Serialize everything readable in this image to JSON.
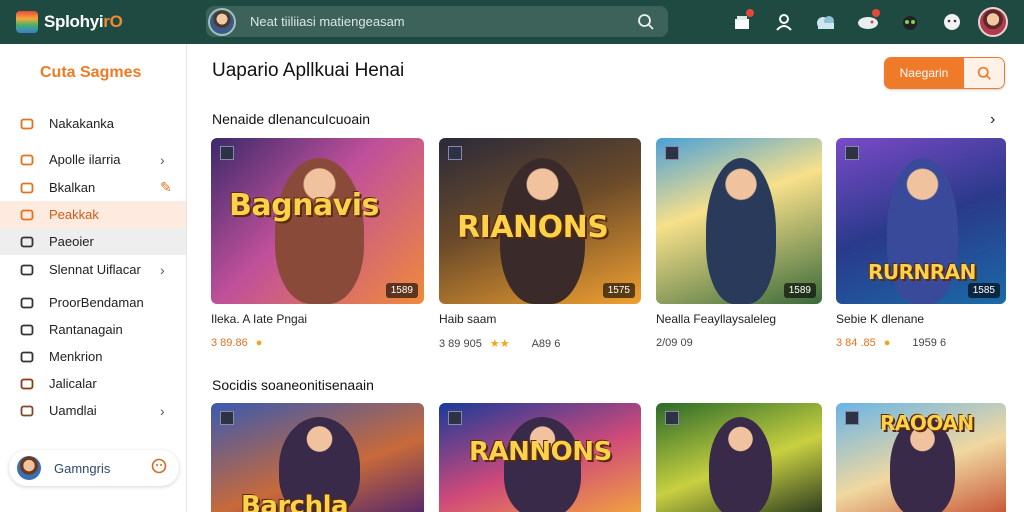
{
  "app": {
    "logo_text": "Splohyi",
    "logo_accent": "rO",
    "search_placeholder": "Neat tiiliiasi matiengeasam",
    "colors": {
      "topbar": "#1f4a42",
      "accent": "#ee7a2a"
    }
  },
  "topbar_icons": [
    "store-icon",
    "profile-icon",
    "cloud-icon",
    "gamepad-icon",
    "alien-icon",
    "face-icon"
  ],
  "sidebar": {
    "title": "Cuta Sagmes",
    "items": [
      {
        "label": "Nakakanka",
        "icon": "briefcase-icon",
        "chevron": ""
      },
      {
        "label": "Apolle ilarria",
        "icon": "clock-icon",
        "chevron": "›"
      },
      {
        "label": "Bkalkan",
        "icon": "bag-icon",
        "chevron": "✎"
      },
      {
        "label": "Peakkak",
        "icon": "tag-icon",
        "chevron": ""
      },
      {
        "label": "Paeoier",
        "icon": "card-icon",
        "chevron": ""
      },
      {
        "label": "Slennat Uiflacar",
        "icon": "shield-icon",
        "chevron": "›"
      },
      {
        "label": "ProorBendaman",
        "icon": "pin-icon",
        "chevron": ""
      },
      {
        "label": "Rantanagain",
        "icon": "home-icon",
        "chevron": ""
      },
      {
        "label": "Menkrion",
        "icon": "list-icon",
        "chevron": ""
      },
      {
        "label": "Jalicalar",
        "icon": "puzzle-icon",
        "chevron": ""
      },
      {
        "label": "Uamdlai",
        "icon": "avatar-icon",
        "chevron": "›"
      }
    ],
    "card_label": "Gamngris"
  },
  "main": {
    "title": "Uapario Apllkuai Henai",
    "cta_label": "Naegarin",
    "section1_title": "Nenaide dlenancuIcuoain",
    "section2_title": "Socidis soaneonitisenaain",
    "games_row1": [
      {
        "art_title": "Bagnavis",
        "count": "1589",
        "name": "Ileka. A Iate Pngai",
        "rating": "3 89.86",
        "extra": ""
      },
      {
        "art_title": "RIANONS",
        "count": "1575",
        "name": "Haib saam",
        "rating": "3 89 905",
        "extra": "A89 6"
      },
      {
        "art_title": "",
        "count": "1589",
        "name": "Nealla Feayllaysaleleg",
        "rating": "2/09 09",
        "extra": ""
      },
      {
        "art_title": "RURNRAN",
        "count": "1585",
        "name": "Sebie K dlenane",
        "rating": "3 84 .85",
        "extra": "1959 6"
      }
    ],
    "games_row2": [
      {
        "art_title": "Barchla"
      },
      {
        "art_title": "RANNONS"
      },
      {
        "art_title": ""
      },
      {
        "art_title": "RAOOAN"
      }
    ]
  }
}
